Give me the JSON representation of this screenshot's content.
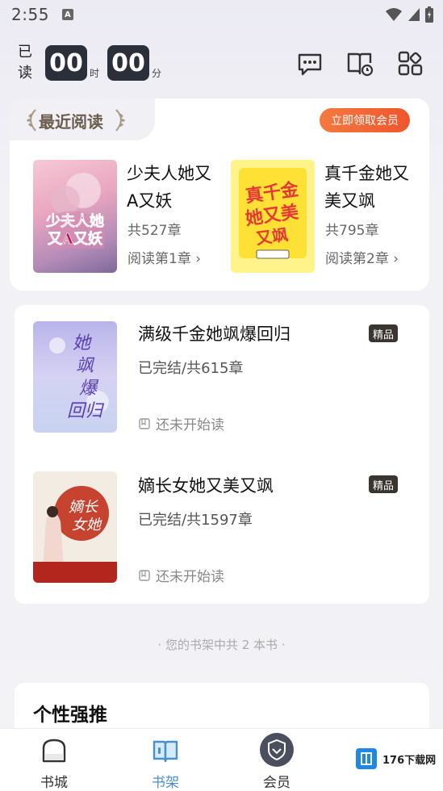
{
  "status_bar": {
    "time": "2:55",
    "notif": "A"
  },
  "header": {
    "read_label": "已读",
    "hours": "00",
    "hours_unit": "时",
    "minutes": "00",
    "minutes_unit": "分"
  },
  "recent": {
    "title": "最近阅读",
    "vip_button": "立即领取会员",
    "books": [
      {
        "title": "少夫人她又A又妖",
        "chapters": "共527章",
        "progress": "阅读第1章 ›",
        "cover_text": "少夫人她又A又妖"
      },
      {
        "title": "真千金她又美又飒",
        "chapters": "共795章",
        "progress": "阅读第2章 ›",
        "cover_text": "真千金她又美又飒"
      }
    ]
  },
  "shelf": {
    "books": [
      {
        "title": "满级千金她飒爆回归",
        "badge": "精品",
        "status": "已完结/共615章",
        "progress": "还未开始读",
        "cover_text": "她飒爆回归"
      },
      {
        "title": "嫡长女她又美又飒",
        "badge": "精品",
        "status": "已完结/共1597章",
        "progress": "还未开始读",
        "cover_text": "嫡长女她"
      }
    ],
    "count_text": "· 您的书架中共 2 本书 ·"
  },
  "recommend": {
    "title": "个性强推"
  },
  "tabbar": {
    "items": [
      {
        "label": "书城"
      },
      {
        "label": "书架"
      },
      {
        "label": "会员"
      }
    ]
  },
  "watermark": "176下载网",
  "colors": {
    "accent": "#f0552d",
    "tab_active": "#4a90c8",
    "dark": "#2b2f3a"
  }
}
